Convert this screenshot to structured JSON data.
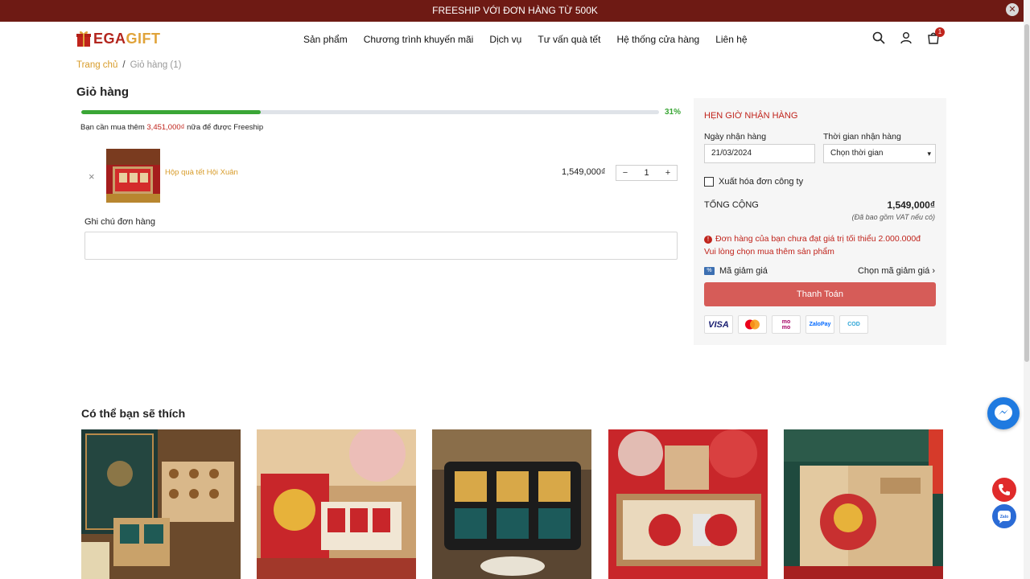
{
  "topbar": {
    "text": "FREESHIP VỚI ĐƠN HÀNG TỪ 500K",
    "close_icon": "close-icon"
  },
  "brand": {
    "logo_main": "EGA",
    "logo_sub": "GIFT"
  },
  "nav": {
    "items": [
      "Sản phẩm",
      "Chương trình khuyến mãi",
      "Dịch vụ",
      "Tư vấn quà tết",
      "Hệ thống cửa hàng",
      "Liên hệ"
    ]
  },
  "header_icons": {
    "search": "search-icon",
    "account": "user-icon",
    "cart": "cart-icon",
    "cart_count": "1"
  },
  "breadcrumb": {
    "home": "Trang chủ",
    "sep": "/",
    "current": "Giỏ hàng (1)"
  },
  "cart": {
    "title": "Giỏ hàng",
    "progress_percent": 31,
    "progress_label": "31%",
    "freeship_prefix": "Bạn cần mua thêm ",
    "freeship_amount": "3,451,000₫",
    "freeship_suffix": " nữa để được Freeship",
    "items": [
      {
        "name": "Hộp quà tết Hội Xuân",
        "price": "1,549,000₫",
        "quantity": "1",
        "remove": "×",
        "minus": "−",
        "plus": "+"
      }
    ],
    "note_label": "Ghi chú đơn hàng"
  },
  "checkout": {
    "schedule_title": "HẸN GIỜ NHẬN HÀNG",
    "date_label": "Ngày nhận hàng",
    "date_value": "21/03/2024",
    "time_label": "Thời gian nhận hàng",
    "time_value": "Chọn thời gian",
    "invoice_label": "Xuất hóa đơn công ty",
    "total_label": "TỔNG CỘNG",
    "total_value": "1,549,000₫",
    "vat_note": "(Đã bao gồm VAT nếu có)",
    "warning_line1": "Đơn hàng của bạn chưa đạt giá trị tối thiểu 2.000.000đ",
    "warning_line2": "Vui lòng chọn mua thêm sản phẩm",
    "discount_label": "Mã giảm giá",
    "discount_choose": "Chọn mã giảm giá",
    "pay_button": "Thanh Toán",
    "payment_methods": [
      "VISA",
      "mastercard",
      "momo",
      "ZaloPay",
      "COD"
    ]
  },
  "suggestions": {
    "title": "Có thể bạn sẽ thích",
    "count": 5
  },
  "colors": {
    "brand_red": "#c0241c",
    "topbar": "#6e1a14",
    "accent_gold": "#d89c2a",
    "progress": "#3aa636",
    "pay_button": "#d65c58"
  }
}
